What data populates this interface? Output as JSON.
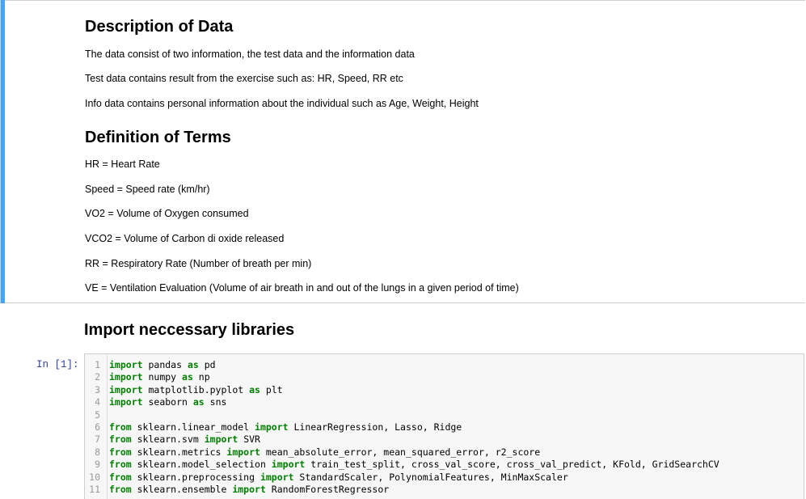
{
  "description_cell": {
    "heading": "Description of Data",
    "lines": [
      "The data consist of two information, the test data and the information data",
      "Test data contains result from the exercise such as: HR, Speed, RR etc",
      "Info data contains personal information about the individual such as Age, Weight, Height"
    ],
    "terms_heading": "Definition of Terms",
    "terms": [
      "HR = Heart Rate",
      "Speed = Speed rate (km/hr)",
      "VO2 = Volume of Oxygen consumed",
      "VCO2 = Volume of Carbon di oxide released",
      "RR = Respiratory Rate (Number of breath per min)",
      "VE = Ventilation Evaluation (Volume of air breath in and out of the lungs in a given period of time)"
    ]
  },
  "import_cell": {
    "heading": "Import neccessary libraries"
  },
  "code_cell": {
    "prompt": "In [1]:",
    "lines": [
      {
        "n": "1",
        "kw1": "import",
        "a": " pandas ",
        "kw2": "as",
        "b": " pd"
      },
      {
        "n": "2",
        "kw1": "import",
        "a": " numpy ",
        "kw2": "as",
        "b": " np"
      },
      {
        "n": "3",
        "kw1": "import",
        "a": " matplotlib.pyplot ",
        "kw2": "as",
        "b": " plt"
      },
      {
        "n": "4",
        "kw1": "import",
        "a": " seaborn ",
        "kw2": "as",
        "b": " sns"
      },
      {
        "n": "5",
        "kw1": "",
        "a": "",
        "kw2": "",
        "b": ""
      },
      {
        "n": "6",
        "kw1": "from",
        "a": " sklearn.linear_model ",
        "kw2": "import",
        "b": " LinearRegression, Lasso, Ridge"
      },
      {
        "n": "7",
        "kw1": "from",
        "a": " sklearn.svm ",
        "kw2": "import",
        "b": " SVR"
      },
      {
        "n": "8",
        "kw1": "from",
        "a": " sklearn.metrics ",
        "kw2": "import",
        "b": " mean_absolute_error, mean_squared_error, r2_score"
      },
      {
        "n": "9",
        "kw1": "from",
        "a": " sklearn.model_selection ",
        "kw2": "import",
        "b": " train_test_split, cross_val_score, cross_val_predict, KFold, GridSearchCV"
      },
      {
        "n": "10",
        "kw1": "from",
        "a": " sklearn.preprocessing ",
        "kw2": "import",
        "b": " StandardScaler, PolynomialFeatures, MinMaxScaler"
      },
      {
        "n": "11",
        "kw1": "from",
        "a": " sklearn.ensemble ",
        "kw2": "import",
        "b": " RandomForestRegressor"
      }
    ]
  },
  "colors": {
    "selection_bar": "#42a5f5",
    "keyword": "#008000",
    "prompt": "#303f9f"
  }
}
